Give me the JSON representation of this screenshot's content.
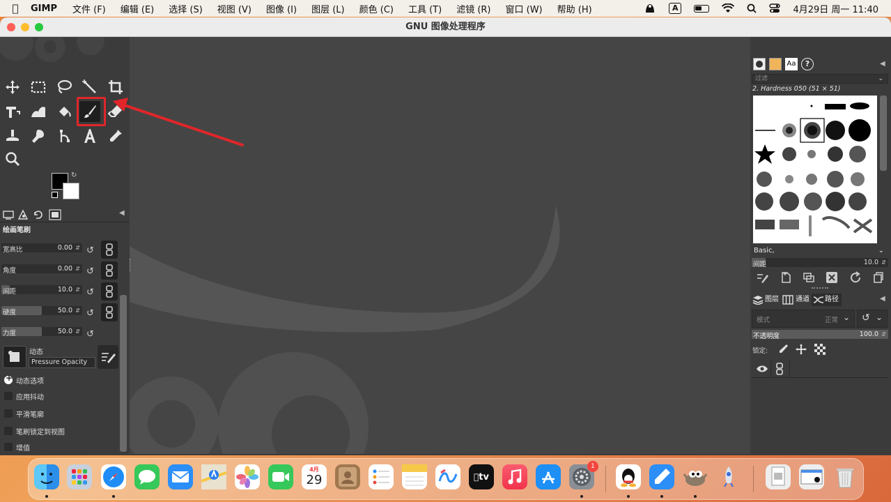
{
  "menubar": {
    "app_name": "GIMP",
    "menus": [
      "文件 (F)",
      "编辑 (E)",
      "选择 (S)",
      "视图 (V)",
      "图像 (I)",
      "图层 (L)",
      "颜色 (C)",
      "工具 (T)",
      "滤镜 (R)",
      "窗口 (W)",
      "帮助 (H)"
    ],
    "input_method": "A",
    "datetime": "4月29日 周一  11:40"
  },
  "window": {
    "title": "GNU 图像处理程序"
  },
  "tool_options": {
    "title": "绘画笔刷",
    "rows": [
      {
        "label": "宽高比",
        "value": "0.00",
        "level": 0.0
      },
      {
        "label": "角度",
        "value": "0.00",
        "level": 0.0
      },
      {
        "label": "间距",
        "value": "10.0",
        "level": 0.1
      },
      {
        "label": "硬度",
        "value": "50.0",
        "level": 0.5
      },
      {
        "label": "力度",
        "value": "50.0",
        "level": 0.5
      }
    ],
    "dynamics_label": "动态",
    "dynamics_value": "Pressure Opacity",
    "dynamics_options": "动态选项",
    "checks": [
      "应用抖动",
      "平滑笔廓",
      "笔刷锁定到视图",
      "增值"
    ]
  },
  "brushes": {
    "filter_placeholder": "过滤",
    "selected": "2. Hardness 050 (51 × 51)",
    "preset": "Basic,",
    "spacing_label": "间距",
    "spacing_value": "10.0"
  },
  "layers": {
    "tabs": [
      "图层",
      "通道",
      "路径"
    ],
    "mode_label": "模式",
    "mode_value": "正常",
    "opacity_label": "不透明度",
    "opacity_value": "100.0",
    "lock_label": "锁定:"
  },
  "dock": {
    "calendar_month": "4月",
    "calendar_day": "29",
    "settings_badge": "1",
    "tv_label": "tv"
  },
  "colors": {
    "highlight": "#e0262a",
    "canvas_bg": "#454545",
    "panel_bg": "#3b3b3b"
  }
}
